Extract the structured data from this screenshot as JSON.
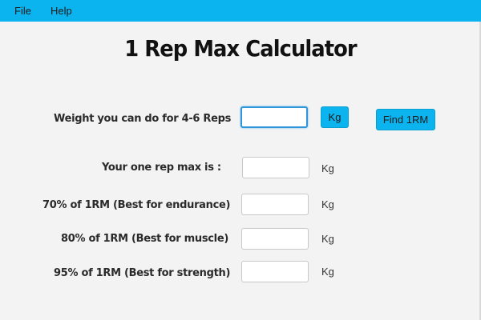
{
  "menubar": {
    "items": [
      "File",
      "Help"
    ]
  },
  "title": "1 Rep Max Calculator",
  "input_row": {
    "label": "Weight you can do for 4-6 Reps",
    "value": "",
    "unit_button": "Kg",
    "action_button": "Find 1RM"
  },
  "results": [
    {
      "label": "Your one rep max is :",
      "value": "",
      "unit": "Kg"
    },
    {
      "label": "70% of 1RM  (Best for endurance)",
      "value": "",
      "unit": "Kg"
    },
    {
      "label": "80% of 1RM (Best for muscle)",
      "value": "",
      "unit": "Kg"
    },
    {
      "label": "95% of 1RM (Best for strength)",
      "value": "",
      "unit": "Kg"
    }
  ],
  "colors": {
    "accent": "#0bb4ee",
    "background": "#f3f3f3"
  }
}
